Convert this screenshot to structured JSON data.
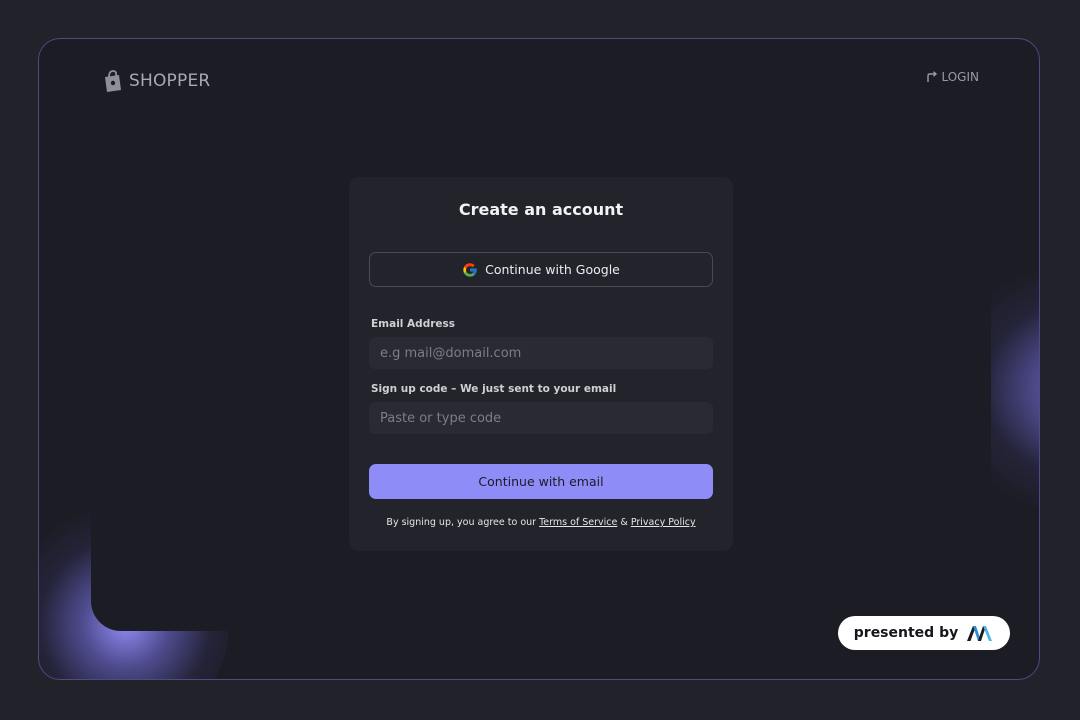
{
  "brand": {
    "name": "SHOPPER",
    "icon": "shopping-bag-icon"
  },
  "header": {
    "login_label": "LOGIN",
    "login_icon": "login-arrow-icon"
  },
  "signup_card": {
    "title": "Create an account",
    "google_button_label": "Continue with Google",
    "google_icon": "google-icon",
    "email": {
      "label": "Email Address",
      "placeholder": "e.g mail@domail.com",
      "value": ""
    },
    "code": {
      "label": "Sign up code – We just sent to your email",
      "placeholder": "Paste or type code",
      "value": ""
    },
    "submit_label": "Continue with email",
    "terms": {
      "prefix": "By signing up, you agree to our ",
      "tos_label": "Terms of Service",
      "separator": " & ",
      "privacy_label": "Privacy Policy"
    }
  },
  "badge": {
    "text": "presented by",
    "logo": "presenter-logo-icon"
  },
  "colors": {
    "background": "#22222a",
    "frame": "#1c1c24",
    "frame_border": "#4f4a86",
    "card": "#23232b",
    "accent": "#8e8cf6",
    "glow": "#9691ff"
  }
}
